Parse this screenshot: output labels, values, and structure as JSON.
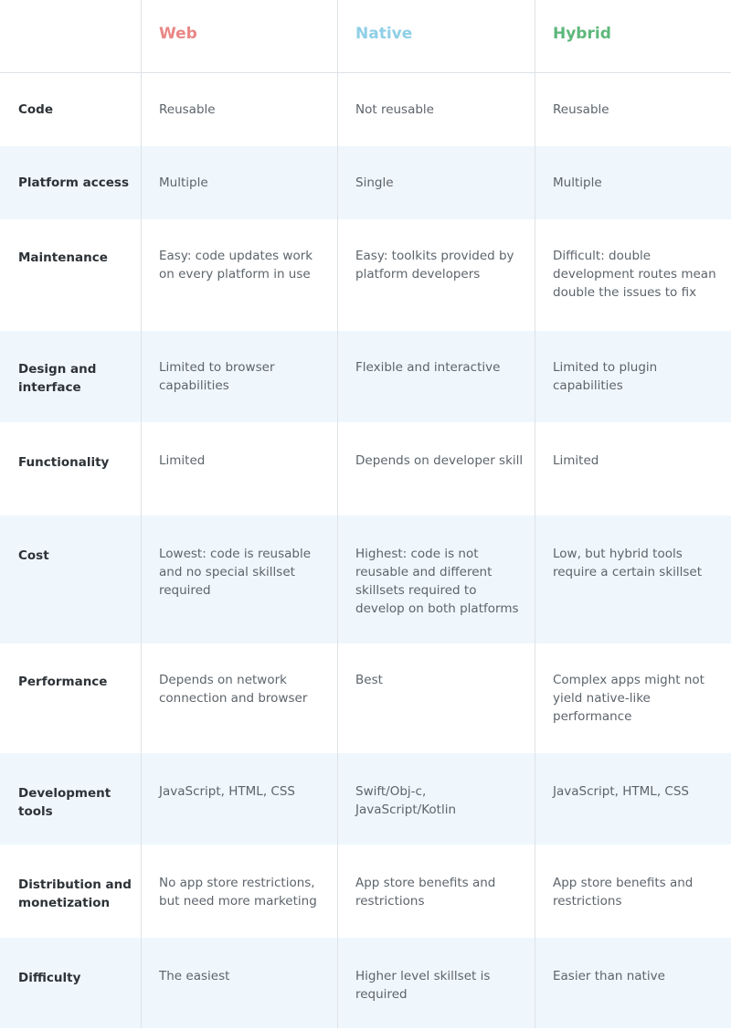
{
  "header": {
    "columns": [
      {
        "label": "",
        "color": ""
      },
      {
        "label": "Web",
        "color": "#ea8686"
      },
      {
        "label": "Native",
        "color": "#8ecfe7"
      },
      {
        "label": "Hybrid",
        "color": "#5db77b"
      }
    ]
  },
  "rows": [
    {
      "label": "Code",
      "web": "Reusable",
      "native": "Not reusable",
      "hybrid": "Reusable"
    },
    {
      "label": "Platform access",
      "web": "Multiple",
      "native": "Single",
      "hybrid": "Multiple"
    },
    {
      "label": "Maintenance",
      "web": "Easy: code updates work on every platform in use",
      "native": "Easy: toolkits provided by platform developers",
      "hybrid": "Difficult: double development routes mean double the issues to fix"
    },
    {
      "label": "Design and interface",
      "web": "Limited to browser capabilities",
      "native": "Flexible and interactive",
      "hybrid": "Limited to plugin capabilities"
    },
    {
      "label": "Functionality",
      "web": "Limited",
      "native": "Depends on developer skill",
      "hybrid": "Limited"
    },
    {
      "label": "Cost",
      "web": "Lowest: code is reusable and no special skillset required",
      "native": "Highest: code is not reusable and different skillsets required to develop on both platforms",
      "hybrid": "Low, but hybrid tools require a certain skillset"
    },
    {
      "label": "Performance",
      "web": "Depends on network connection and browser",
      "native": "Best",
      "hybrid": "Complex apps might not yield native-like performance"
    },
    {
      "label": "Development tools",
      "web": "JavaScript, HTML, CSS",
      "native": "Swift/Obj-c, JavaScript/Kotlin",
      "hybrid": "JavaScript, HTML, CSS"
    },
    {
      "label": "Distribution and monetization",
      "web": "No app store restrictions, but need more marketing",
      "native": "App store benefits and restrictions",
      "hybrid": "App store benefits and restrictions"
    },
    {
      "label": "Difficulty",
      "web": "The easiest",
      "native": "Higher level skillset is required",
      "hybrid": "Easier than native"
    }
  ]
}
